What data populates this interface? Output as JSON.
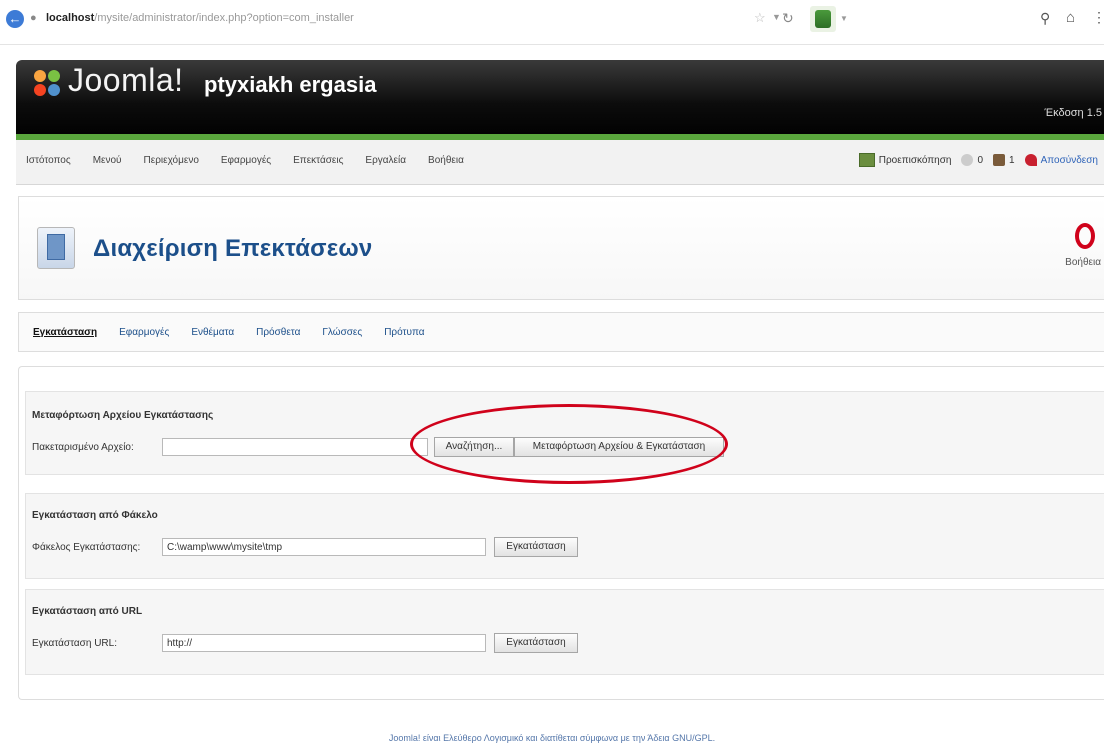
{
  "browser": {
    "url_host": "localhost",
    "url_path": "/mysite/administrator/index.php?option=com_installer",
    "icons": [
      "back-icon",
      "star-icon",
      "reload-icon",
      "addon-icon",
      "search-icon",
      "home-icon",
      "more-icon"
    ]
  },
  "header": {
    "logo_text": "Joomla!",
    "site_name": "ptyxiakh ergasia",
    "version": "Έκδοση 1.5"
  },
  "menu": {
    "items": [
      "Ιστότοπος",
      "Μενού",
      "Περιεχόμενο",
      "Εφαρμογές",
      "Επεκτάσεις",
      "Εργαλεία",
      "Βοήθεια"
    ],
    "preview_label": "Προεπισκόπηση",
    "messages_count": "0",
    "users_count": "1",
    "logout_label": "Αποσύνδεση"
  },
  "page": {
    "title": "Διαχείριση Επεκτάσεων",
    "help_label": "Βοήθεια"
  },
  "tabs": [
    {
      "label": "Εγκατάσταση",
      "active": true
    },
    {
      "label": "Εφαρμογές",
      "active": false
    },
    {
      "label": "Ενθέματα",
      "active": false
    },
    {
      "label": "Πρόσθετα",
      "active": false
    },
    {
      "label": "Γλώσσες",
      "active": false
    },
    {
      "label": "Πρότυπα",
      "active": false
    }
  ],
  "upload": {
    "section_title": "Μεταφόρτωση Αρχείου Εγκατάστασης",
    "field_label": "Πακεταρισμένο Αρχείο:",
    "browse_button": "Αναζήτηση...",
    "upload_button": "Μεταφόρτωση Αρχείου & Εγκατάσταση"
  },
  "directory": {
    "section_title": "Εγκατάσταση από Φάκελο",
    "field_label": "Φάκελος Εγκατάστασης:",
    "field_value": "C:\\wamp\\www\\mysite\\tmp",
    "install_button": "Εγκατάσταση"
  },
  "url": {
    "section_title": "Εγκατάσταση από URL",
    "field_label": "Εγκατάσταση URL:",
    "field_value": "http://",
    "install_button": "Εγκατάσταση"
  },
  "footer": {
    "text": "Joomla! είναι Ελεύθερο Λογισμικό και διατίθεται σύμφωνα με την Άδεια GNU/GPL."
  },
  "colors": {
    "accent_green": "#5aa73d",
    "title_blue": "#1c4f8a",
    "highlight_red": "#d0021b"
  }
}
